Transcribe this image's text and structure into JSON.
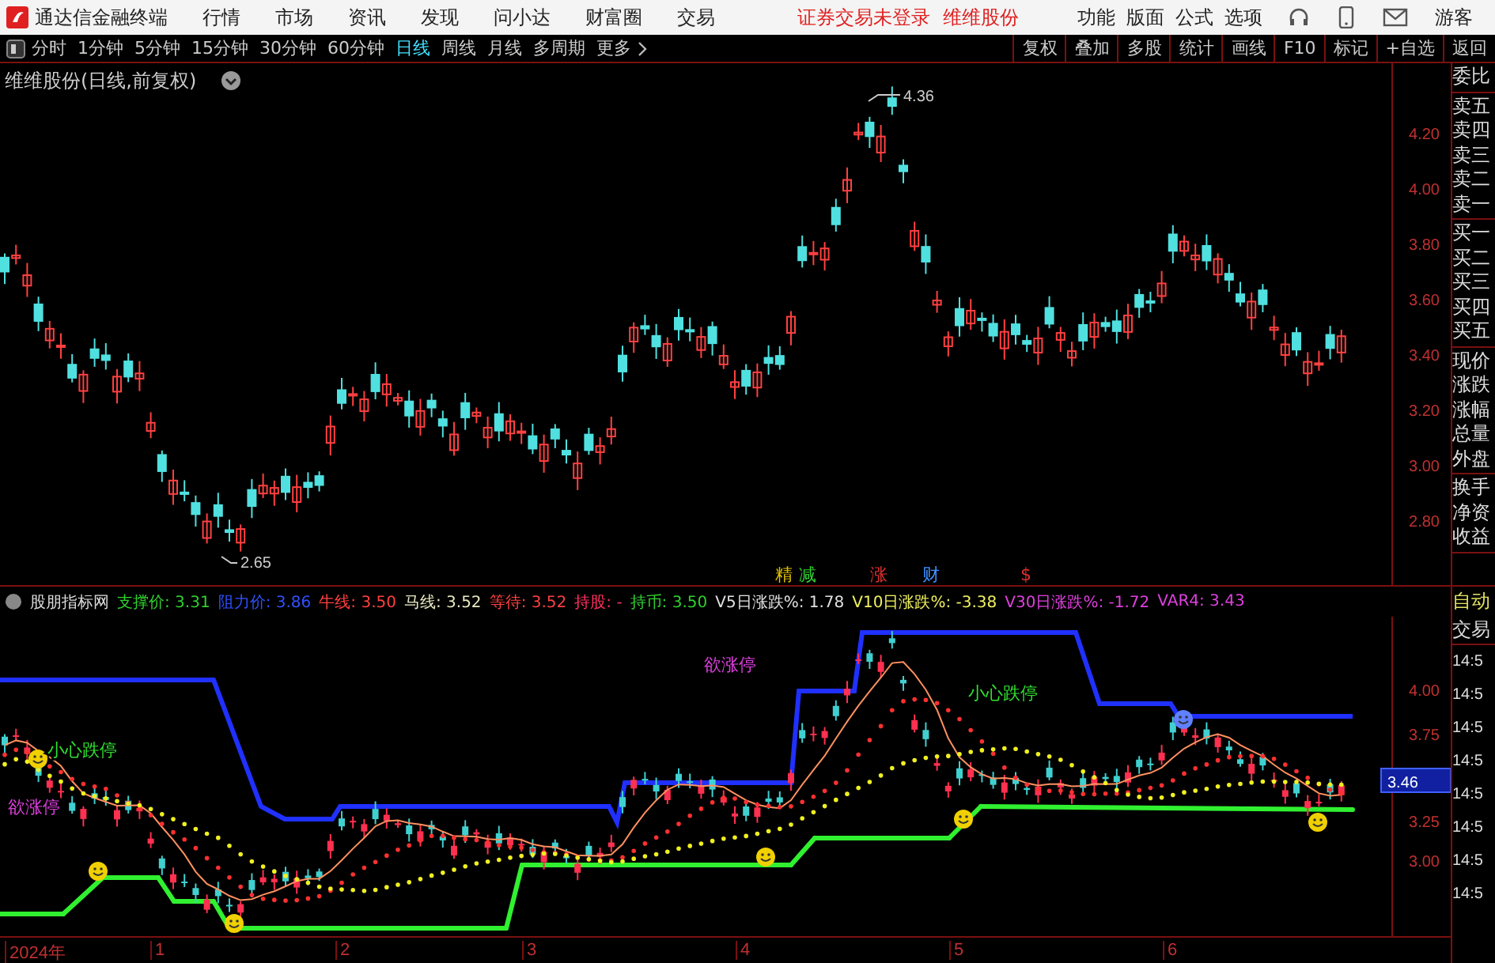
{
  "app": {
    "title": "通达信金融终端"
  },
  "menu": [
    "行情",
    "市场",
    "资讯",
    "发现",
    "问小达",
    "财富圈",
    "交易"
  ],
  "notices": [
    "证券交易未登录",
    "维维股份"
  ],
  "top_right": [
    "功能",
    "版面",
    "公式",
    "选项"
  ],
  "user": "游客",
  "periods": [
    {
      "label": "分时",
      "selected": false
    },
    {
      "label": "1分钟",
      "selected": false
    },
    {
      "label": "5分钟",
      "selected": false
    },
    {
      "label": "15分钟",
      "selected": false
    },
    {
      "label": "30分钟",
      "selected": false
    },
    {
      "label": "60分钟",
      "selected": false
    },
    {
      "label": "日线",
      "selected": true
    },
    {
      "label": "周线",
      "selected": false
    },
    {
      "label": "月线",
      "selected": false
    },
    {
      "label": "多周期",
      "selected": false
    },
    {
      "label": "更多",
      "selected": false
    }
  ],
  "tools": [
    "复权",
    "叠加",
    "多股",
    "统计",
    "画线",
    "F10",
    "标记",
    "+自选",
    "返回"
  ],
  "chart": {
    "title": "维维股份(日线,前复权)",
    "y_ticks": [
      "4.20",
      "4.00",
      "3.80",
      "3.60",
      "3.40",
      "3.20",
      "3.00",
      "2.80"
    ],
    "high_label": "4.36",
    "low_label": "2.65",
    "markers": [
      {
        "text": "精",
        "color": "#e0c000"
      },
      {
        "text": "减",
        "color": "#30d030"
      },
      {
        "text": "涨",
        "color": "#e03030"
      },
      {
        "text": "财",
        "color": "#4090ff"
      },
      {
        "text": "$",
        "color": "#e03030"
      }
    ]
  },
  "indicator": {
    "name": "股朋指标网",
    "items": [
      {
        "text": "支撑价: 3.31",
        "color": "#30d030"
      },
      {
        "text": "阻力价: 3.86",
        "color": "#3050ff"
      },
      {
        "text": "牛线: 3.50",
        "color": "#ff4040"
      },
      {
        "text": "马线: 3.52",
        "color": "#e8e8c0"
      },
      {
        "text": "等待: 3.52",
        "color": "#ff4040"
      },
      {
        "text": "持股: -",
        "color": "#ff3060"
      },
      {
        "text": "持币: 3.50",
        "color": "#30d030"
      },
      {
        "text": "V5日涨跌%: 1.78",
        "color": "#e0e0e0"
      },
      {
        "text": "V10日涨跌%: -3.38",
        "color": "#f0f060"
      },
      {
        "text": "V30日涨跌%: -1.72",
        "color": "#e040e0"
      },
      {
        "text": "VAR4: 3.43",
        "color": "#e040e0"
      }
    ],
    "y_ticks": [
      "4.00",
      "3.75",
      "3.25",
      "3.00"
    ],
    "current": "3.46",
    "labels": [
      {
        "text": "小心跌停",
        "color": "#30e030"
      },
      {
        "text": "小心跌停",
        "color": "#30e030"
      },
      {
        "text": "欲涨停",
        "color": "#e040e0"
      },
      {
        "text": "欲涨停",
        "color": "#e040e0"
      }
    ]
  },
  "x_axis": [
    "2024年",
    "1",
    "2",
    "3",
    "4",
    "5",
    "6"
  ],
  "quote_panel": {
    "groups": [
      [
        "委比"
      ],
      [
        "卖五",
        "卖四",
        "卖三",
        "卖二",
        "卖一"
      ],
      [
        "买一",
        "买二",
        "买三",
        "买四",
        "买五"
      ],
      [
        "现价",
        "涨跌",
        "涨幅",
        "总量",
        "外盘"
      ],
      [
        "换手",
        "净资",
        "收益"
      ]
    ]
  },
  "trade_panel": {
    "title": "自动",
    "subtitle": "交易",
    "times": [
      "14:5",
      "14:5",
      "14:5",
      "14:5",
      "14:5",
      "14:5",
      "14:5",
      "14:5"
    ]
  }
}
